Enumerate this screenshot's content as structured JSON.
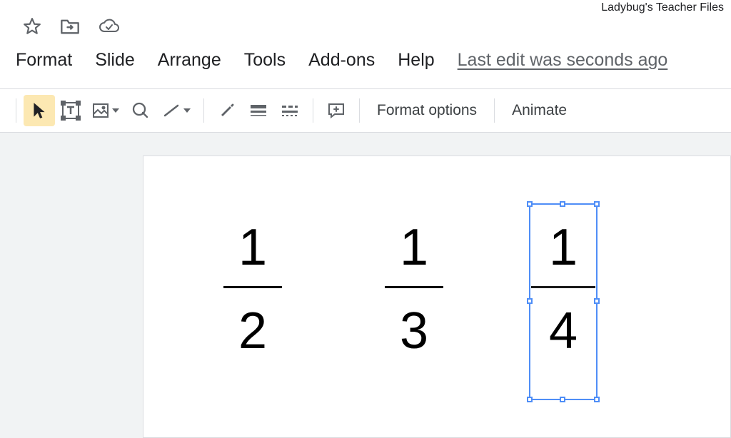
{
  "attribution": "Ladybug's Teacher Files",
  "menubar": {
    "format": "Format",
    "slide": "Slide",
    "arrange": "Arrange",
    "tools": "Tools",
    "addons": "Add-ons",
    "help": "Help",
    "last_edit": "Last edit was seconds ago"
  },
  "toolbar": {
    "format_options": "Format options",
    "animate": "Animate"
  },
  "slide": {
    "fractions": [
      {
        "numerator": "1",
        "denominator": "2"
      },
      {
        "numerator": "1",
        "denominator": "3"
      },
      {
        "numerator": "1",
        "denominator": "4",
        "selected": true
      }
    ]
  }
}
